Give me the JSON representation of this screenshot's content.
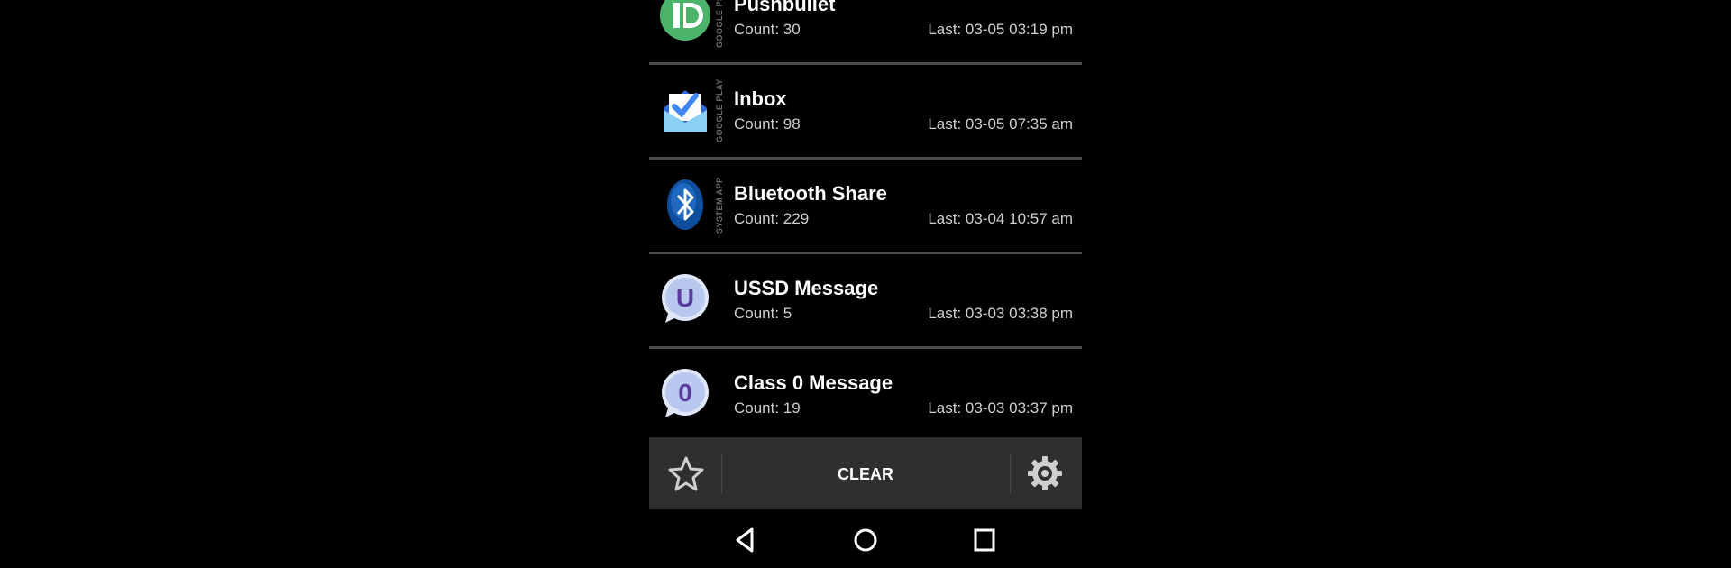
{
  "notifications": [
    {
      "name": "Pushbullet",
      "count": "Count: 30",
      "last": "Last: 03-05 03:19 pm",
      "source": "GOOGLE PLAY",
      "icon": "pushbullet-icon"
    },
    {
      "name": "Inbox",
      "count": "Count: 98",
      "last": "Last: 03-05 07:35 am",
      "source": "GOOGLE PLAY",
      "icon": "inbox-icon"
    },
    {
      "name": "Bluetooth Share",
      "count": "Count: 229",
      "last": "Last: 03-04 10:57 am",
      "source": "SYSTEM APP",
      "icon": "bluetooth-icon"
    },
    {
      "name": "USSD Message",
      "count": "Count: 5",
      "last": "Last: 03-03 03:38 pm",
      "source": "",
      "icon": "ussd-bubble-icon",
      "glyph": "U"
    },
    {
      "name": "Class 0 Message",
      "count": "Count: 19",
      "last": "Last: 03-03 03:37 pm",
      "source": "",
      "icon": "class0-bubble-icon",
      "glyph": "0"
    }
  ],
  "actionbar": {
    "clear_label": "CLEAR",
    "left_icon": "star-outline-icon",
    "right_icon": "gear-icon"
  },
  "navbar": {
    "back_icon": "back-triangle-icon",
    "home_icon": "home-circle-icon",
    "recents_icon": "recents-square-icon"
  },
  "colors": {
    "background": "#000000",
    "row_divider": "#4a4a4a",
    "actionbar": "#2f2f2f",
    "pushbullet_green": "#4cb36a",
    "inbox_blue": "#4285f4",
    "bluetooth_blue": "#1463b8",
    "bubble_purple": "#5a3a9a"
  }
}
